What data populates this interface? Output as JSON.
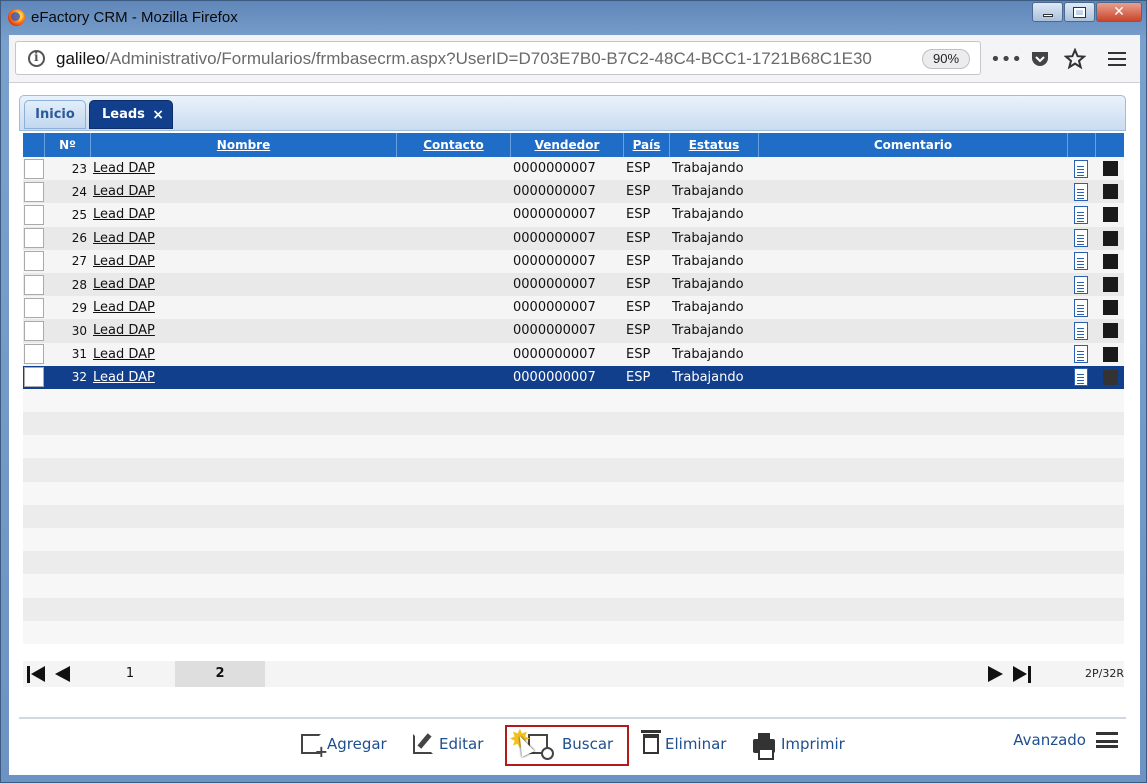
{
  "window": {
    "title": "eFactory CRM - Mozilla Firefox"
  },
  "browser": {
    "url_host": "galileo",
    "url_path": "/Administrativo/Formularios/frmbasecrm.aspx?UserID=D703E7B0-B7C2-48C4-BCC1-1721B68C1E30",
    "zoom": "90%"
  },
  "tabs": [
    {
      "label": "Inicio",
      "active": false
    },
    {
      "label": "Leads",
      "active": true,
      "close": "×"
    }
  ],
  "grid": {
    "columns": [
      "Nº",
      "Nombre",
      "Contacto",
      "Vendedor",
      "País",
      "Estatus",
      "Comentario"
    ],
    "rows": [
      {
        "no": "23",
        "nombre": "Lead DAP",
        "contacto": "",
        "vendedor": "0000000007",
        "pais": "ESP",
        "estatus": "Trabajando",
        "comentario": ""
      },
      {
        "no": "24",
        "nombre": "Lead DAP",
        "contacto": "",
        "vendedor": "0000000007",
        "pais": "ESP",
        "estatus": "Trabajando",
        "comentario": ""
      },
      {
        "no": "25",
        "nombre": "Lead DAP",
        "contacto": "",
        "vendedor": "0000000007",
        "pais": "ESP",
        "estatus": "Trabajando",
        "comentario": ""
      },
      {
        "no": "26",
        "nombre": "Lead DAP",
        "contacto": "",
        "vendedor": "0000000007",
        "pais": "ESP",
        "estatus": "Trabajando",
        "comentario": ""
      },
      {
        "no": "27",
        "nombre": "Lead DAP",
        "contacto": "",
        "vendedor": "0000000007",
        "pais": "ESP",
        "estatus": "Trabajando",
        "comentario": ""
      },
      {
        "no": "28",
        "nombre": "Lead DAP",
        "contacto": "",
        "vendedor": "0000000007",
        "pais": "ESP",
        "estatus": "Trabajando",
        "comentario": ""
      },
      {
        "no": "29",
        "nombre": "Lead DAP",
        "contacto": "",
        "vendedor": "0000000007",
        "pais": "ESP",
        "estatus": "Trabajando",
        "comentario": ""
      },
      {
        "no": "30",
        "nombre": "Lead DAP",
        "contacto": "",
        "vendedor": "0000000007",
        "pais": "ESP",
        "estatus": "Trabajando",
        "comentario": ""
      },
      {
        "no": "31",
        "nombre": "Lead DAP",
        "contacto": "",
        "vendedor": "0000000007",
        "pais": "ESP",
        "estatus": "Trabajando",
        "comentario": ""
      },
      {
        "no": "32",
        "nombre": "Lead DAP",
        "contacto": "",
        "vendedor": "0000000007",
        "pais": "ESP",
        "estatus": "Trabajando",
        "comentario": "",
        "selected": true
      }
    ]
  },
  "pager": {
    "pages": [
      "1",
      "2"
    ],
    "active_page": "2",
    "info": "2P/32R"
  },
  "toolbar": {
    "agregar": "Agregar",
    "editar": "Editar",
    "buscar": "Buscar",
    "eliminar": "Eliminar",
    "imprimir": "Imprimir",
    "avanzado": "Avanzado"
  },
  "colors": {
    "header_blue": "#1f6dc6",
    "selected_row": "#123f8c",
    "highlight_border": "#b01c1c"
  }
}
